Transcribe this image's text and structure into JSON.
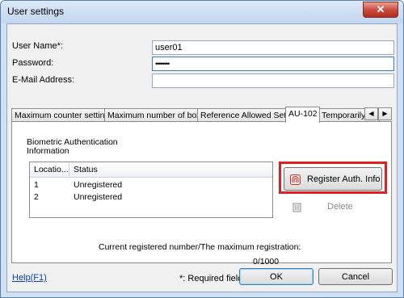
{
  "window": {
    "title": "User settings",
    "close_glyph": "✕"
  },
  "form": {
    "user_name_label": "User Name*:",
    "user_name_value": "user01",
    "password_label": "Password:",
    "password_value": "••••••••",
    "email_label": "E-Mail Address:",
    "email_value": ""
  },
  "tabs": [
    {
      "label": "Maximum counter settings"
    },
    {
      "label": "Maximum number of boxes"
    },
    {
      "label": "Reference Allowed Setting"
    },
    {
      "label": "AU-102"
    },
    {
      "label": "Temporarily Disa"
    }
  ],
  "tab_scroll": {
    "left": "◀",
    "right": "▶"
  },
  "panel": {
    "bio_label": "Biometric Authentication Information",
    "columns": [
      "Locatio...",
      "Status"
    ],
    "rows": [
      {
        "location": "1",
        "status": "Unregistered"
      },
      {
        "location": "2",
        "status": "Unregistered"
      }
    ],
    "register_label": "Register Auth. Info",
    "delete_label": "Delete",
    "registered_label": "Current registered number/The maximum registration:",
    "registered_count": "0/1000"
  },
  "footer": {
    "help_label": "Help(F1)",
    "required_note": "*: Required field",
    "ok_label": "OK",
    "cancel_label": "Cancel"
  },
  "colors": {
    "highlight": "#e02020",
    "link": "#0645ad"
  },
  "icons": [
    "close-icon",
    "fingerprint-icon",
    "delete-icon",
    "scroll-left-icon",
    "scroll-right-icon"
  ]
}
